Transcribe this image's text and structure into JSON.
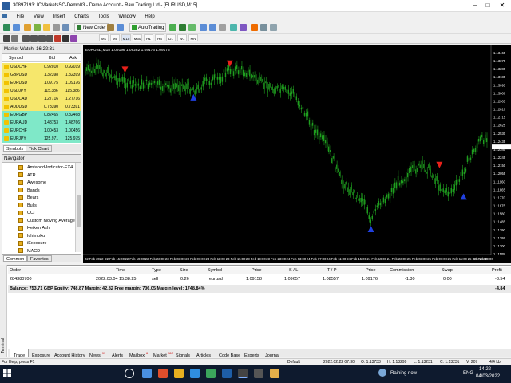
{
  "window": {
    "title": "30897193: ICMarketsSC-Demo03 - Demo Account - Raw Trading Ltd - [EURUSD,M15]"
  },
  "menu": [
    "File",
    "View",
    "Insert",
    "Charts",
    "Tools",
    "Window",
    "Help"
  ],
  "toolbar": {
    "new_order": "New Order",
    "autotrading": "AutoTrading",
    "timeframes": [
      "M1",
      "M5",
      "M15",
      "M30",
      "H1",
      "H4",
      "D1",
      "W1",
      "MN"
    ]
  },
  "market_watch": {
    "title": "Market Watch: 16:22:31",
    "col_symbol": "Symbol",
    "col_bid": "Bid",
    "col_ask": "Ask",
    "rows": [
      {
        "symbol": "USDCHF",
        "bid": "0.92010",
        "ask": "0.92019",
        "bg": "#f6e76c"
      },
      {
        "symbol": "GBPUSD",
        "bid": "1.32398",
        "ask": "1.32399",
        "bg": "#f6e76c"
      },
      {
        "symbol": "EURUSD",
        "bid": "1.09175",
        "ask": "1.09176",
        "bg": "#f6e76c"
      },
      {
        "symbol": "USDJPY",
        "bid": "115.386",
        "ask": "115.386",
        "bg": "#f6e76c"
      },
      {
        "symbol": "USDCAD",
        "bid": "1.27716",
        "ask": "1.27716",
        "bg": "#f6e76c"
      },
      {
        "symbol": "AUDUSD",
        "bid": "0.73390",
        "ask": "0.73391",
        "bg": "#f6e76c"
      },
      {
        "symbol": "EURGBP",
        "bid": "0.82465",
        "ask": "0.82468",
        "bg": "#7fe8c8"
      },
      {
        "symbol": "EURAUD",
        "bid": "1.48753",
        "ask": "1.48766",
        "bg": "#7fe8c8"
      },
      {
        "symbol": "EURCHF",
        "bid": "1.00453",
        "ask": "1.00456",
        "bg": "#7fe8c8"
      },
      {
        "symbol": "EURJPY",
        "bid": "125.971",
        "ask": "125.975",
        "bg": "#7fe8c8"
      }
    ],
    "tabs": [
      "Symbols",
      "Tick Chart"
    ]
  },
  "navigator": {
    "title": "Navigator",
    "items": [
      "Amtabod-Indicator-EX4",
      "ATR",
      "Awesome",
      "Bands",
      "Bears",
      "Bulls",
      "CCI",
      "Custom Moving Averages",
      "Heiken Ashi",
      "Ichimoku",
      "iExposure",
      "MACD"
    ],
    "tabs": [
      "Common",
      "Favorites"
    ]
  },
  "chart": {
    "header": "EURUSD,M15  1.09196 1.09282 1.09173 1.09175",
    "price_labels": [
      "1.13465",
      "1.13375",
      "1.13285",
      "1.13185",
      "1.13095",
      "1.13000",
      "1.12905",
      "1.12810",
      "1.12715",
      "1.12625",
      "1.12530",
      "1.12435",
      "1.12340",
      "1.12245",
      "1.12150",
      "1.12055",
      "1.11960",
      "1.11865",
      "1.11770",
      "1.11675",
      "1.11580",
      "1.11485",
      "1.11390",
      "1.11295",
      "1.11200",
      "1.11105"
    ],
    "time_labels": [
      "22 Feb 2022",
      "22 Feb 15:00",
      "22 Feb 19:00",
      "22 Feb 23:00",
      "23 Feb 03:00",
      "23 Feb 07:00",
      "23 Feb 11:00",
      "23 Feb 15:00",
      "23 Feb 19:00",
      "23 Feb 23:00",
      "24 Feb 03:00",
      "24 Feb 07:00",
      "24 Feb 11:00",
      "24 Feb 15:00",
      "24 Feb 19:00",
      "24 Feb 23:00",
      "25 Feb 03:00",
      "25 Feb 07:00",
      "25 Feb 11:00",
      "25 Feb 15:00",
      "25 Feb 19:00"
    ],
    "colors": {
      "background": "#000000",
      "candles": "#1f9e1f",
      "sell_arrow": "#e8201a",
      "buy_arrow": "#2040e0",
      "axis_text": "#ffffff"
    }
  },
  "terminal": {
    "columns": [
      "Order",
      "Time",
      "Type",
      "Size",
      "Symbol",
      "Price",
      "S / L",
      "T / P",
      "Price",
      "Commission",
      "Swap",
      "Profit"
    ],
    "order": {
      "order": "284380700",
      "time": "2022.03.04 15:38:25",
      "type": "sell",
      "size": "0.26",
      "symbol": "eurusd",
      "price": "1.09158",
      "sl": "1.09657",
      "tp": "1.08557",
      "price_now": "1.09176",
      "commission": "-1.30",
      "swap": "0.00",
      "profit": "-3.54"
    },
    "balance_line": "Balance: 753.71 GBP  Equity: 748.87  Margin: 42.82  Free margin: 706.05  Margin level: 1748.84%",
    "balance_profit": "-4.84",
    "tabs": [
      {
        "label": "Trade",
        "badge": ""
      },
      {
        "label": "Exposure",
        "badge": ""
      },
      {
        "label": "Account History",
        "badge": ""
      },
      {
        "label": "News",
        "badge": "99"
      },
      {
        "label": "Alerts",
        "badge": ""
      },
      {
        "label": "Mailbox",
        "badge": "6"
      },
      {
        "label": "Market",
        "badge": "112"
      },
      {
        "label": "Signals",
        "badge": ""
      },
      {
        "label": "Articles",
        "badge": ""
      },
      {
        "label": "Code Base",
        "badge": ""
      },
      {
        "label": "Experts",
        "badge": ""
      },
      {
        "label": "Journal",
        "badge": ""
      }
    ],
    "side_label": "Terminal"
  },
  "statusbar": {
    "help": "For Help, press F1",
    "profile": "Default",
    "datetime": "2022.02.22 07:30",
    "o": "O: 1.13733",
    "h": "H: 1.13299",
    "l": "L: 1.13231",
    "c": "C: 1.13231",
    "v": "V: 207",
    "kb": "4/4 kb"
  },
  "taskbar": {
    "weather": "Raining now",
    "lang": "ENG",
    "time": "14:22",
    "date": "04/03/2022"
  }
}
